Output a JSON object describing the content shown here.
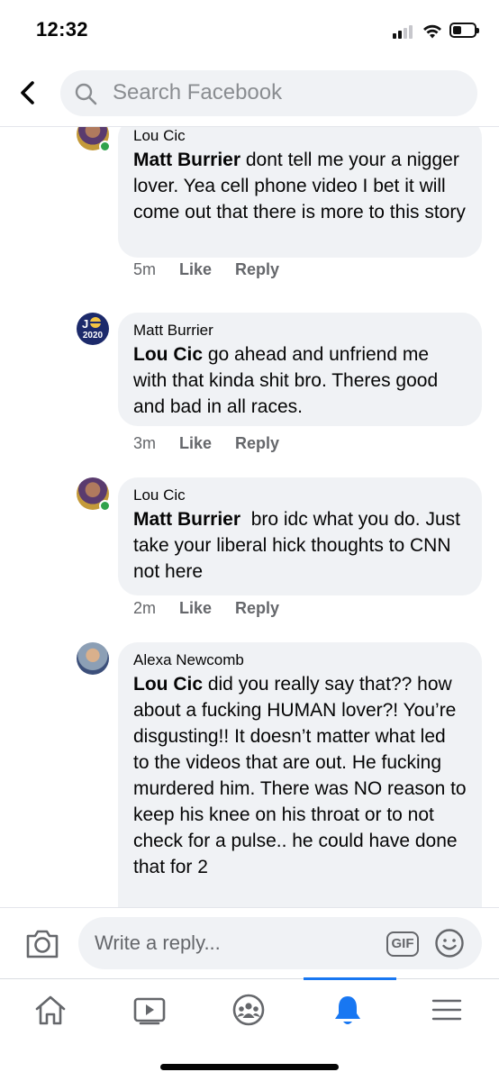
{
  "status_bar": {
    "time": "12:32",
    "icons": [
      "cellular-signal-icon",
      "wifi-icon",
      "battery-icon"
    ]
  },
  "header": {
    "back_icon": "chevron-left-icon",
    "search_icon": "search-icon",
    "search_placeholder": "Search Facebook"
  },
  "comments": [
    {
      "author": "Lou Cic",
      "mention": "Matt Burrier",
      "text": " dont tell me your a nigger lover. Yea cell phone video I bet it will come out that there is more to this story",
      "time": "5m",
      "like_label": "Like",
      "reply_label": "Reply",
      "online": true
    },
    {
      "author": "Matt Burrier",
      "mention": "Lou Cic",
      "text": " go ahead and unfriend me with that kinda shit bro. Theres good and bad in all races.",
      "time": "3m",
      "like_label": "Like",
      "reply_label": "Reply",
      "online": false,
      "avatar_text": "2020"
    },
    {
      "author": "Lou Cic",
      "mention": "Matt Burrier",
      "text": "  bro idc what you do. Just take your liberal hick thoughts to CNN not here",
      "time": "2m",
      "like_label": "Like",
      "reply_label": "Reply",
      "online": true
    },
    {
      "author": "Alexa Newcomb",
      "mention": "Lou Cic",
      "text": " did you really say that?? how about a fucking HUMAN lover?! You’re disgusting!! It doesn’t matter what led to the videos that are out. He fucking murdered him. There was NO reason to keep his knee on his throat or to not check for a pulse.. he could have done that for 2",
      "online": false
    }
  ],
  "composer": {
    "camera_icon": "camera-icon",
    "placeholder": "Write a reply...",
    "gif_label": "GIF",
    "emoji_icon": "emoji-icon"
  },
  "tabbar": {
    "tabs": [
      {
        "icon": "home-icon",
        "active": false
      },
      {
        "icon": "watch-video-icon",
        "active": false
      },
      {
        "icon": "groups-icon",
        "active": false
      },
      {
        "icon": "notifications-bell-icon",
        "active": true
      },
      {
        "icon": "menu-icon",
        "active": false
      }
    ],
    "accent_color": "#1877f2"
  }
}
